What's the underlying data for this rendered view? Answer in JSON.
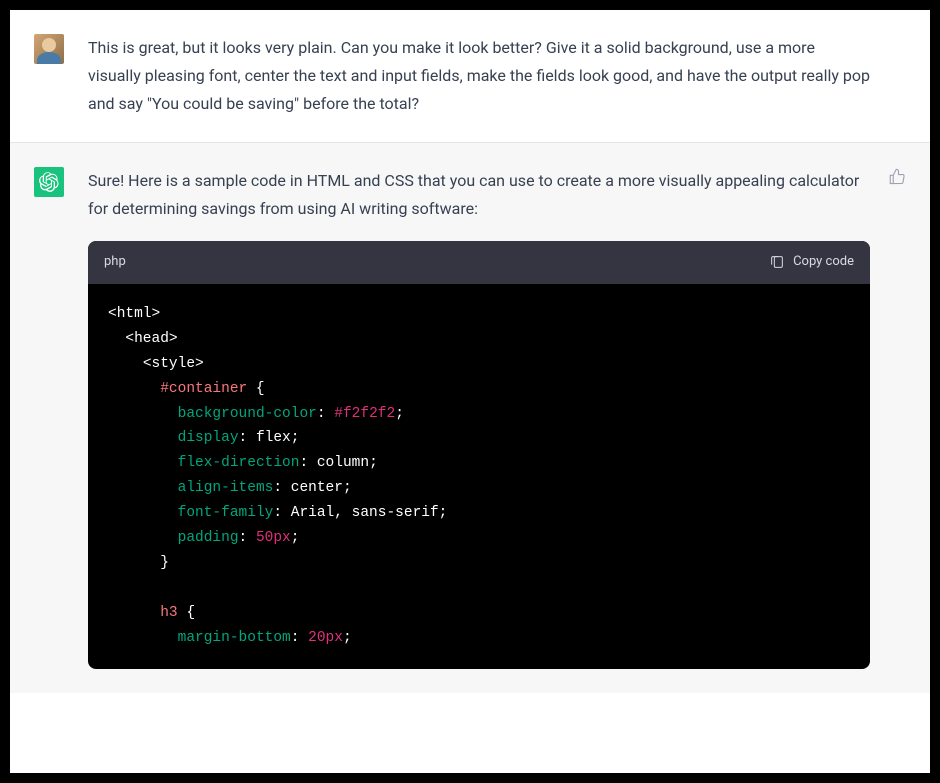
{
  "user": {
    "message": "This is great, but it looks very plain. Can you make it look better? Give it a solid background, use a more visually pleasing font, center the text and input fields, make the fields look good, and have the output really pop and say \"You could be saving\" before the total?"
  },
  "assistant": {
    "intro": "Sure! Here is a sample code in HTML and CSS that you can use to create a more visually appealing calculator for determining savings from using AI writing software:",
    "code": {
      "language_label": "php",
      "copy_label": "Copy code",
      "lines": [
        [
          {
            "t": "<html>",
            "c": "t-default"
          }
        ],
        [
          {
            "t": "  ",
            "c": "t-default"
          },
          {
            "t": "<head>",
            "c": "t-default"
          }
        ],
        [
          {
            "t": "    ",
            "c": "t-default"
          },
          {
            "t": "<style>",
            "c": "t-default"
          }
        ],
        [
          {
            "t": "      ",
            "c": "t-default"
          },
          {
            "t": "#container",
            "c": "t-selector"
          },
          {
            "t": " {",
            "c": "t-default"
          }
        ],
        [
          {
            "t": "        ",
            "c": "t-default"
          },
          {
            "t": "background-color",
            "c": "t-prop"
          },
          {
            "t": ": ",
            "c": "t-default"
          },
          {
            "t": "#f2f2f2",
            "c": "t-value"
          },
          {
            "t": ";",
            "c": "t-default"
          }
        ],
        [
          {
            "t": "        ",
            "c": "t-default"
          },
          {
            "t": "display",
            "c": "t-prop"
          },
          {
            "t": ": flex;",
            "c": "t-default"
          }
        ],
        [
          {
            "t": "        ",
            "c": "t-default"
          },
          {
            "t": "flex-direction",
            "c": "t-prop"
          },
          {
            "t": ": column;",
            "c": "t-default"
          }
        ],
        [
          {
            "t": "        ",
            "c": "t-default"
          },
          {
            "t": "align-items",
            "c": "t-prop"
          },
          {
            "t": ": center;",
            "c": "t-default"
          }
        ],
        [
          {
            "t": "        ",
            "c": "t-default"
          },
          {
            "t": "font-family",
            "c": "t-prop"
          },
          {
            "t": ": Arial, sans-serif;",
            "c": "t-default"
          }
        ],
        [
          {
            "t": "        ",
            "c": "t-default"
          },
          {
            "t": "padding",
            "c": "t-prop"
          },
          {
            "t": ": ",
            "c": "t-default"
          },
          {
            "t": "50px",
            "c": "t-value"
          },
          {
            "t": ";",
            "c": "t-default"
          }
        ],
        [
          {
            "t": "      }",
            "c": "t-default"
          }
        ],
        [
          {
            "t": "",
            "c": "t-default"
          }
        ],
        [
          {
            "t": "      ",
            "c": "t-default"
          },
          {
            "t": "h3",
            "c": "t-selector"
          },
          {
            "t": " {",
            "c": "t-default"
          }
        ],
        [
          {
            "t": "        ",
            "c": "t-default"
          },
          {
            "t": "margin-bottom",
            "c": "t-prop"
          },
          {
            "t": ": ",
            "c": "t-default"
          },
          {
            "t": "20px",
            "c": "t-value"
          },
          {
            "t": ";",
            "c": "t-default"
          }
        ]
      ]
    }
  },
  "icons": {
    "thumbs_up": "thumbs-up-icon",
    "clipboard": "clipboard-icon",
    "assistant_logo": "openai-logo-icon"
  }
}
